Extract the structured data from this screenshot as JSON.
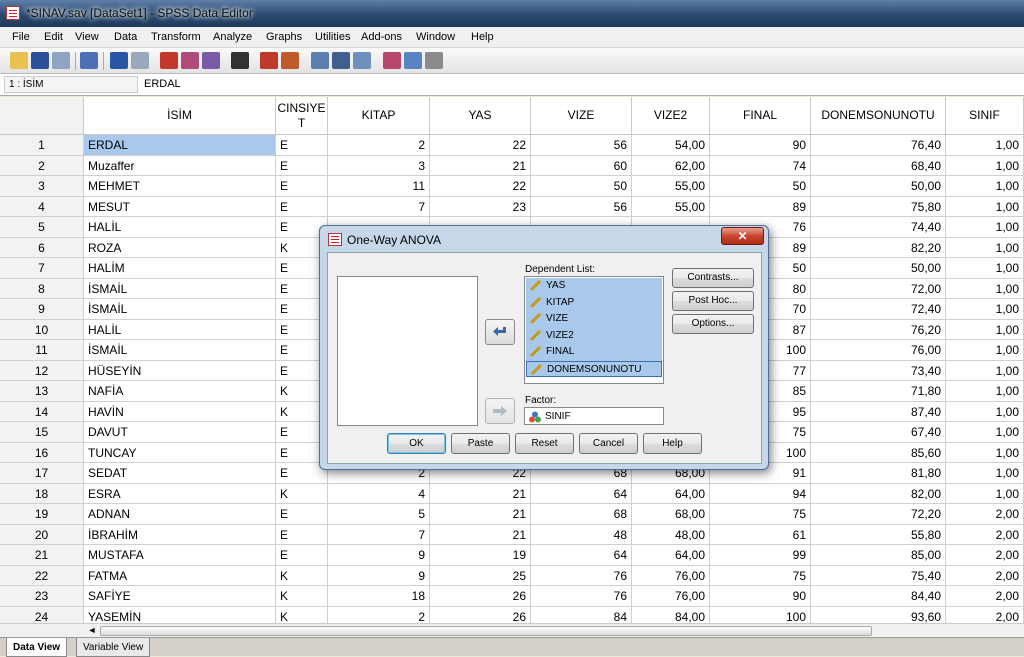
{
  "window": {
    "title": "*SINAV.sav [DataSet1] - SPSS Data Editor"
  },
  "menu": [
    "File",
    "Edit",
    "View",
    "Data",
    "Transform",
    "Analyze",
    "Graphs",
    "Utilities",
    "Add-ons",
    "Window",
    "Help"
  ],
  "cell_editor": {
    "ref": "1 : İSİM",
    "value": "ERDAL"
  },
  "columns": [
    "İSİM",
    "CINSIYE T",
    "KITAP",
    "YAS",
    "VIZE",
    "VIZE2",
    "FINAL",
    "DONEMSONUNOTU",
    "SINIF"
  ],
  "rows": [
    {
      "n": "1",
      "isim": "ERDAL",
      "cins": "E",
      "kitap": "2",
      "yas": "22",
      "vize": "56",
      "vize2": "54,00",
      "final": "90",
      "dsn": "76,40",
      "sinif": "1,00"
    },
    {
      "n": "2",
      "isim": "Muzaffer",
      "cins": "E",
      "kitap": "3",
      "yas": "21",
      "vize": "60",
      "vize2": "62,00",
      "final": "74",
      "dsn": "68,40",
      "sinif": "1,00"
    },
    {
      "n": "3",
      "isim": "MEHMET",
      "cins": "E",
      "kitap": "11",
      "yas": "22",
      "vize": "50",
      "vize2": "55,00",
      "final": "50",
      "dsn": "50,00",
      "sinif": "1,00"
    },
    {
      "n": "4",
      "isim": "MESUT",
      "cins": "E",
      "kitap": "7",
      "yas": "23",
      "vize": "56",
      "vize2": "55,00",
      "final": "89",
      "dsn": "75,80",
      "sinif": "1,00"
    },
    {
      "n": "5",
      "isim": "HALİL",
      "cins": "E",
      "kitap": "",
      "yas": "",
      "vize": "",
      "vize2": "",
      "final": "76",
      "dsn": "74,40",
      "sinif": "1,00"
    },
    {
      "n": "6",
      "isim": "ROZA",
      "cins": "K",
      "kitap": "",
      "yas": "",
      "vize": "",
      "vize2": "",
      "final": "89",
      "dsn": "82,20",
      "sinif": "1,00"
    },
    {
      "n": "7",
      "isim": "HALİM",
      "cins": "E",
      "kitap": "",
      "yas": "",
      "vize": "",
      "vize2": "",
      "final": "50",
      "dsn": "50,00",
      "sinif": "1,00"
    },
    {
      "n": "8",
      "isim": "İSMAİL",
      "cins": "E",
      "kitap": "",
      "yas": "",
      "vize": "",
      "vize2": "",
      "final": "80",
      "dsn": "72,00",
      "sinif": "1,00"
    },
    {
      "n": "9",
      "isim": "İSMAİL",
      "cins": "E",
      "kitap": "",
      "yas": "",
      "vize": "",
      "vize2": "",
      "final": "70",
      "dsn": "72,40",
      "sinif": "1,00"
    },
    {
      "n": "10",
      "isim": "HALİL",
      "cins": "E",
      "kitap": "",
      "yas": "",
      "vize": "",
      "vize2": "",
      "final": "87",
      "dsn": "76,20",
      "sinif": "1,00"
    },
    {
      "n": "11",
      "isim": "İSMAİL",
      "cins": "E",
      "kitap": "",
      "yas": "",
      "vize": "",
      "vize2": "",
      "final": "100",
      "dsn": "76,00",
      "sinif": "1,00"
    },
    {
      "n": "12",
      "isim": "HÜSEYİN",
      "cins": "E",
      "kitap": "",
      "yas": "",
      "vize": "",
      "vize2": "",
      "final": "77",
      "dsn": "73,40",
      "sinif": "1,00"
    },
    {
      "n": "13",
      "isim": "NAFİA",
      "cins": "K",
      "kitap": "",
      "yas": "",
      "vize": "",
      "vize2": "",
      "final": "85",
      "dsn": "71,80",
      "sinif": "1,00"
    },
    {
      "n": "14",
      "isim": "HAVİN",
      "cins": "K",
      "kitap": "",
      "yas": "",
      "vize": "",
      "vize2": "",
      "final": "95",
      "dsn": "87,40",
      "sinif": "1,00"
    },
    {
      "n": "15",
      "isim": "DAVUT",
      "cins": "E",
      "kitap": "",
      "yas": "",
      "vize": "",
      "vize2": "",
      "final": "75",
      "dsn": "67,40",
      "sinif": "1,00"
    },
    {
      "n": "16",
      "isim": "TUNCAY",
      "cins": "E",
      "kitap": "",
      "yas": "",
      "vize": "",
      "vize2": "",
      "final": "100",
      "dsn": "85,60",
      "sinif": "1,00"
    },
    {
      "n": "17",
      "isim": "SEDAT",
      "cins": "E",
      "kitap": "2",
      "yas": "22",
      "vize": "68",
      "vize2": "68,00",
      "final": "91",
      "dsn": "81,80",
      "sinif": "1,00"
    },
    {
      "n": "18",
      "isim": "ESRA",
      "cins": "K",
      "kitap": "4",
      "yas": "21",
      "vize": "64",
      "vize2": "64,00",
      "final": "94",
      "dsn": "82,00",
      "sinif": "1,00"
    },
    {
      "n": "19",
      "isim": "ADNAN",
      "cins": "E",
      "kitap": "5",
      "yas": "21",
      "vize": "68",
      "vize2": "68,00",
      "final": "75",
      "dsn": "72,20",
      "sinif": "2,00"
    },
    {
      "n": "20",
      "isim": "İBRAHİM",
      "cins": "E",
      "kitap": "7",
      "yas": "21",
      "vize": "48",
      "vize2": "48,00",
      "final": "61",
      "dsn": "55,80",
      "sinif": "2,00"
    },
    {
      "n": "21",
      "isim": "MUSTAFA",
      "cins": "E",
      "kitap": "9",
      "yas": "19",
      "vize": "64",
      "vize2": "64,00",
      "final": "99",
      "dsn": "85,00",
      "sinif": "2,00"
    },
    {
      "n": "22",
      "isim": "FATMA",
      "cins": "K",
      "kitap": "9",
      "yas": "25",
      "vize": "76",
      "vize2": "76,00",
      "final": "75",
      "dsn": "75,40",
      "sinif": "2,00"
    },
    {
      "n": "23",
      "isim": "SAFİYE",
      "cins": "K",
      "kitap": "18",
      "yas": "26",
      "vize": "76",
      "vize2": "76,00",
      "final": "90",
      "dsn": "84,40",
      "sinif": "2,00"
    },
    {
      "n": "24",
      "isim": "YASEMİN",
      "cins": "K",
      "kitap": "2",
      "yas": "26",
      "vize": "84",
      "vize2": "84,00",
      "final": "100",
      "dsn": "93,60",
      "sinif": "2,00"
    }
  ],
  "tabs": {
    "data_view": "Data View",
    "variable_view": "Variable View"
  },
  "dialog": {
    "title": "One-Way ANOVA",
    "close": "✕",
    "dependent_label": "Dependent List:",
    "dependent": [
      "YAS",
      "KITAP",
      "VIZE",
      "VIZE2",
      "FINAL",
      "DONEMSONUNOTU"
    ],
    "factor_label": "Factor:",
    "factor": "SINIF",
    "side_buttons": {
      "contrasts": "Contrasts...",
      "posthoc": "Post Hoc...",
      "options": "Options..."
    },
    "bottom_buttons": {
      "ok": "OK",
      "paste": "Paste",
      "reset": "Reset",
      "cancel": "Cancel",
      "help": "Help"
    }
  },
  "colors": {
    "selection": "#a9c9ec",
    "dialog_frame": "#c7d7ea",
    "close_button": "#c9452f"
  }
}
